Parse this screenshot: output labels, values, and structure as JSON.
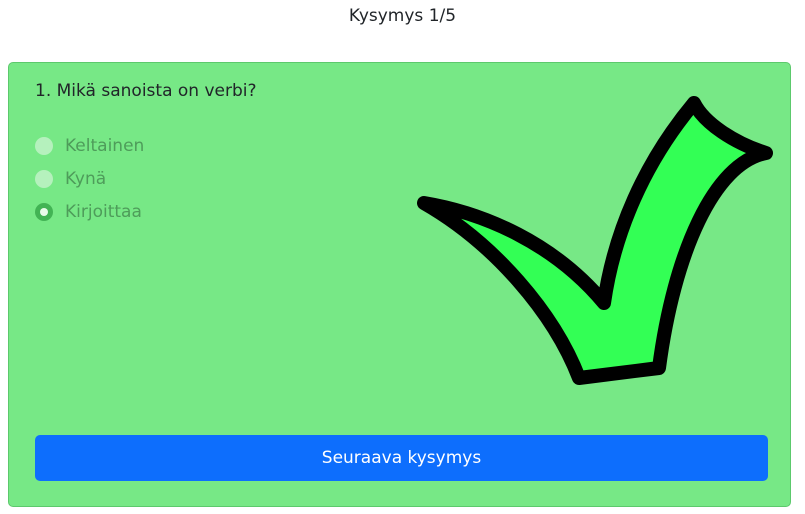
{
  "header": {
    "progress": "Kysymys 1/5"
  },
  "quiz": {
    "question": "1. Mikä sanoista on verbi?",
    "options": [
      {
        "label": "Keltainen",
        "selected": false
      },
      {
        "label": "Kynä",
        "selected": false
      },
      {
        "label": "Kirjoittaa",
        "selected": true
      }
    ],
    "result_icon": "checkmark-icon",
    "result": "correct"
  },
  "footer": {
    "next_label": "Seuraava kysymys"
  },
  "colors": {
    "card_background": "#77e886",
    "checkmark_fill": "#33ff55",
    "button_primary": "#0d6efd"
  }
}
